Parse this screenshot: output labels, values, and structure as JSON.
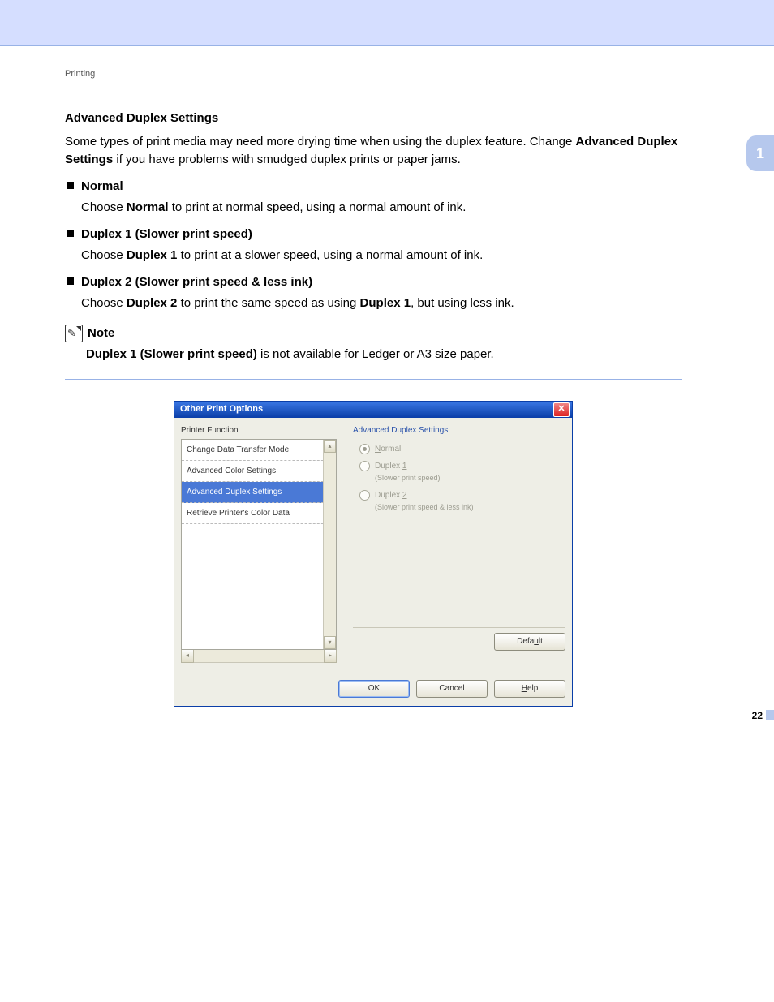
{
  "breadcrumb": "Printing",
  "side_tab": "1",
  "page_number": "22",
  "doc": {
    "heading": "Advanced Duplex Settings",
    "intro_pre": "Some types of print media may need more drying time when using the duplex feature. Change ",
    "intro_bold": "Advanced Duplex Settings",
    "intro_post": " if you have problems with smudged duplex prints or paper jams.",
    "items": [
      {
        "title": "Normal",
        "body_pre": "Choose ",
        "body_bold": "Normal",
        "body_post": " to print at normal speed, using a normal amount of ink."
      },
      {
        "title": "Duplex 1 (Slower print speed)",
        "body_pre": "Choose ",
        "body_bold": "Duplex 1",
        "body_post": " to print at a slower speed, using a normal amount of ink."
      },
      {
        "title": "Duplex 2 (Slower print speed & less ink)",
        "body_pre": "Choose ",
        "body_bold": "Duplex 2",
        "body_mid": " to print the same speed as using ",
        "body_bold2": "Duplex 1",
        "body_post": ", but using less ink."
      }
    ],
    "note_label": "Note",
    "note_bold": "Duplex 1 (Slower print speed)",
    "note_post": " is not available for Ledger or A3 size paper."
  },
  "dialog": {
    "title": "Other Print Options",
    "left_label": "Printer Function",
    "functions": [
      "Change Data Transfer Mode",
      "Advanced Color Settings",
      "Advanced Duplex Settings",
      "Retrieve Printer's Color Data"
    ],
    "selected_index": 2,
    "group_title": "Advanced Duplex Settings",
    "radios": [
      {
        "label_u": "N",
        "label_rest": "ormal",
        "sub": "",
        "checked": true
      },
      {
        "label_u": "1",
        "label_pre": "Duplex ",
        "label_rest": "",
        "sub": "(Slower print speed)",
        "checked": false
      },
      {
        "label_u": "2",
        "label_pre": "Duplex ",
        "label_rest": "",
        "sub": "(Slower print speed & less ink)",
        "checked": false
      }
    ],
    "default_btn": {
      "pre": "Defa",
      "u": "u",
      "post": "lt"
    },
    "ok": "OK",
    "cancel": "Cancel",
    "help": {
      "u": "H",
      "rest": "elp"
    }
  }
}
